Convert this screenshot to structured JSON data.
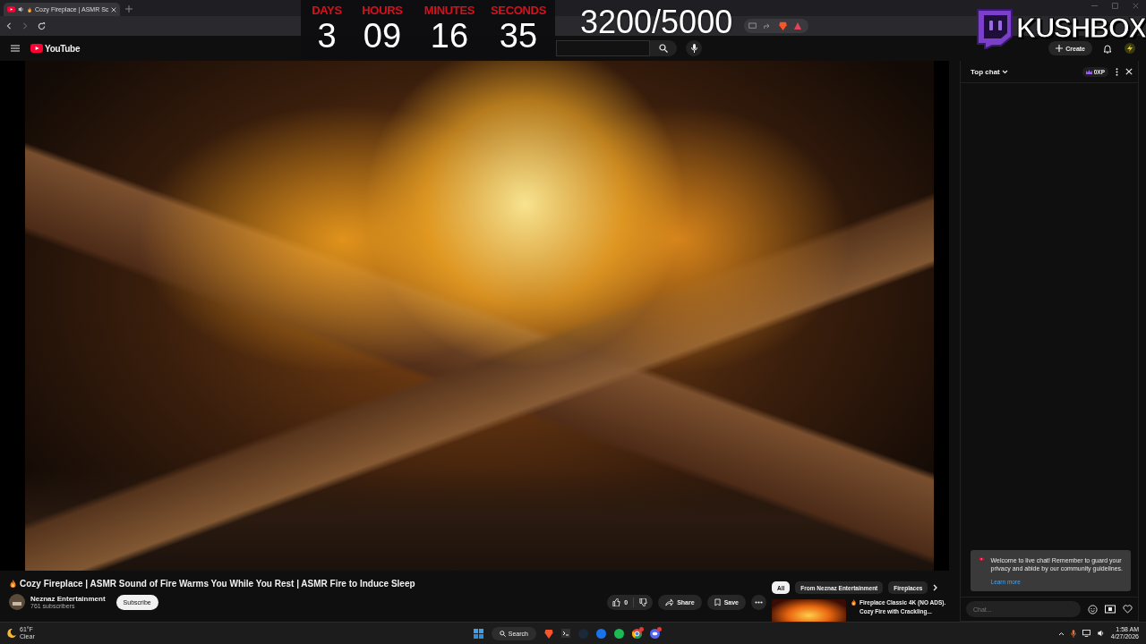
{
  "browser": {
    "tab_title": "Cozy Fireplace | ASMR Sc"
  },
  "youtube_header": {
    "logo": "YouTube",
    "create": "Create"
  },
  "chat": {
    "title": "Top chat",
    "xp": "0XP",
    "notice": "Welcome to live chat! Remember to guard your privacy and abide by our community guidelines.",
    "learn_more": "Learn more",
    "placeholder": "Chat..."
  },
  "video": {
    "title": "Cozy Fireplace | ASMR Sound of Fire Warms You While You Rest | ASMR Fire to Induce Sleep"
  },
  "channel": {
    "name": "Neznaz Entertainment",
    "subscribers": "761 subscribers",
    "subscribe": "Subscribe"
  },
  "actions": {
    "likes": "0",
    "share": "Share",
    "save": "Save"
  },
  "chips": [
    {
      "label": "All",
      "selected": true
    },
    {
      "label": "From Neznaz Entertainment",
      "selected": false
    },
    {
      "label": "Fireplaces",
      "selected": false
    }
  ],
  "recommended": [
    {
      "title": "Fireplace Classic 4K (NO ADS). Cozy Fire with Crackling..."
    }
  ],
  "taskbar": {
    "temperature": "61°F",
    "weather": "Clear",
    "search": "Search",
    "time": "1:58 AM",
    "date": "4/27/2026"
  },
  "overlay": {
    "countdown": [
      {
        "label": "DAYS",
        "value": "3"
      },
      {
        "label": "HOURS",
        "value": "09"
      },
      {
        "label": "MINUTES",
        "value": "16"
      },
      {
        "label": "SECONDS",
        "value": "35"
      }
    ],
    "goal": "3200/5000",
    "brand": "KUSHBOX"
  }
}
